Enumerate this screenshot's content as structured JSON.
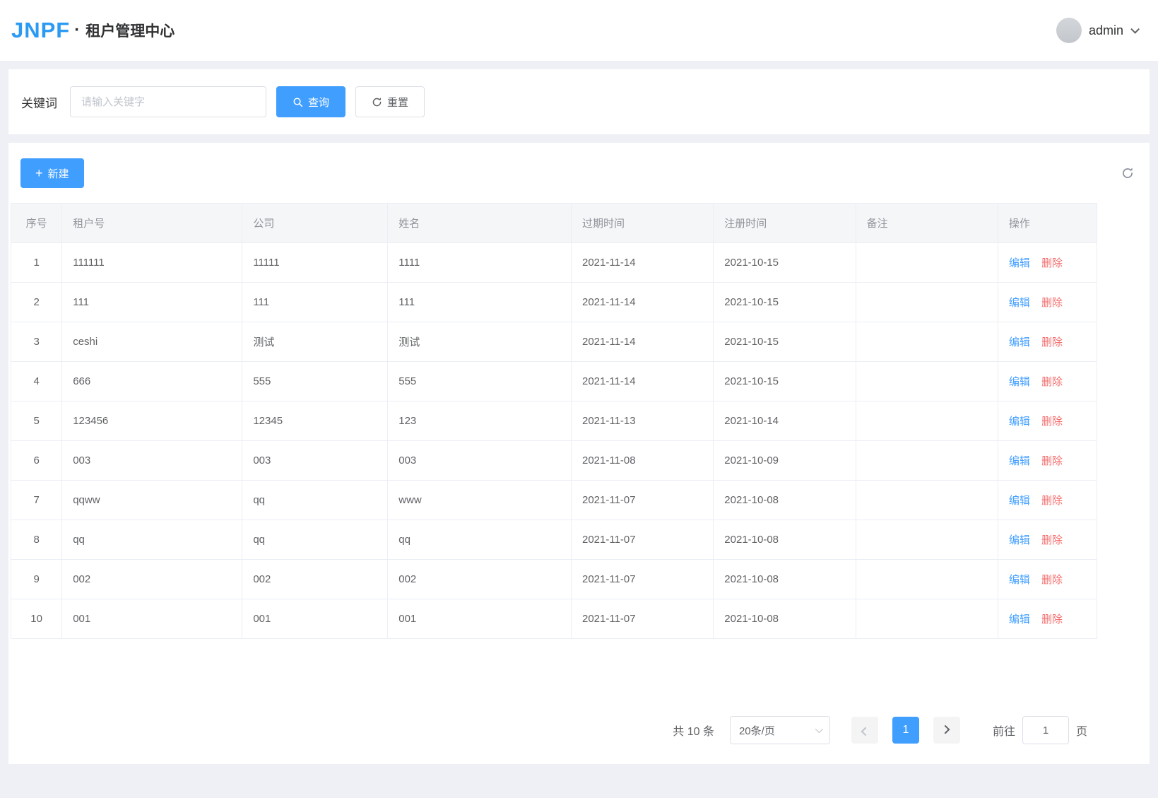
{
  "colors": {
    "accent": "#409EFF",
    "danger": "#F56C6C"
  },
  "header": {
    "logo": "JNPF",
    "separator": "·",
    "title": "租户管理中心",
    "user": "admin"
  },
  "search": {
    "label": "关键词",
    "placeholder": "请输入关键字",
    "query": "查询",
    "reset": "重置"
  },
  "toolbar": {
    "new": "新建",
    "plus": "+"
  },
  "table": {
    "columns": [
      "序号",
      "租户号",
      "公司",
      "姓名",
      "过期时间",
      "注册时间",
      "备注",
      "操作"
    ],
    "edit": "编辑",
    "delete": "删除",
    "rows": [
      {
        "no": "1",
        "tenant": "111111",
        "company": "11111",
        "name": "1111",
        "expire": "2021-11-14",
        "register": "2021-10-15",
        "remark": ""
      },
      {
        "no": "2",
        "tenant": "111",
        "company": "111",
        "name": "111",
        "expire": "2021-11-14",
        "register": "2021-10-15",
        "remark": ""
      },
      {
        "no": "3",
        "tenant": "ceshi",
        "company": "测试",
        "name": "测试",
        "expire": "2021-11-14",
        "register": "2021-10-15",
        "remark": ""
      },
      {
        "no": "4",
        "tenant": "666",
        "company": "555",
        "name": "555",
        "expire": "2021-11-14",
        "register": "2021-10-15",
        "remark": ""
      },
      {
        "no": "5",
        "tenant": "123456",
        "company": "12345",
        "name": "123",
        "expire": "2021-11-13",
        "register": "2021-10-14",
        "remark": ""
      },
      {
        "no": "6",
        "tenant": "003",
        "company": "003",
        "name": "003",
        "expire": "2021-11-08",
        "register": "2021-10-09",
        "remark": ""
      },
      {
        "no": "7",
        "tenant": "qqww",
        "company": "qq",
        "name": "www",
        "expire": "2021-11-07",
        "register": "2021-10-08",
        "remark": ""
      },
      {
        "no": "8",
        "tenant": "qq",
        "company": "qq",
        "name": "qq",
        "expire": "2021-11-07",
        "register": "2021-10-08",
        "remark": ""
      },
      {
        "no": "9",
        "tenant": "002",
        "company": "002",
        "name": "002",
        "expire": "2021-11-07",
        "register": "2021-10-08",
        "remark": ""
      },
      {
        "no": "10",
        "tenant": "001",
        "company": "001",
        "name": "001",
        "expire": "2021-11-07",
        "register": "2021-10-08",
        "remark": ""
      }
    ]
  },
  "pagination": {
    "total": "共 10 条",
    "page_size": "20条/页",
    "current_page": "1",
    "goto_label": "前往",
    "goto_value": "1",
    "page_unit": "页"
  }
}
